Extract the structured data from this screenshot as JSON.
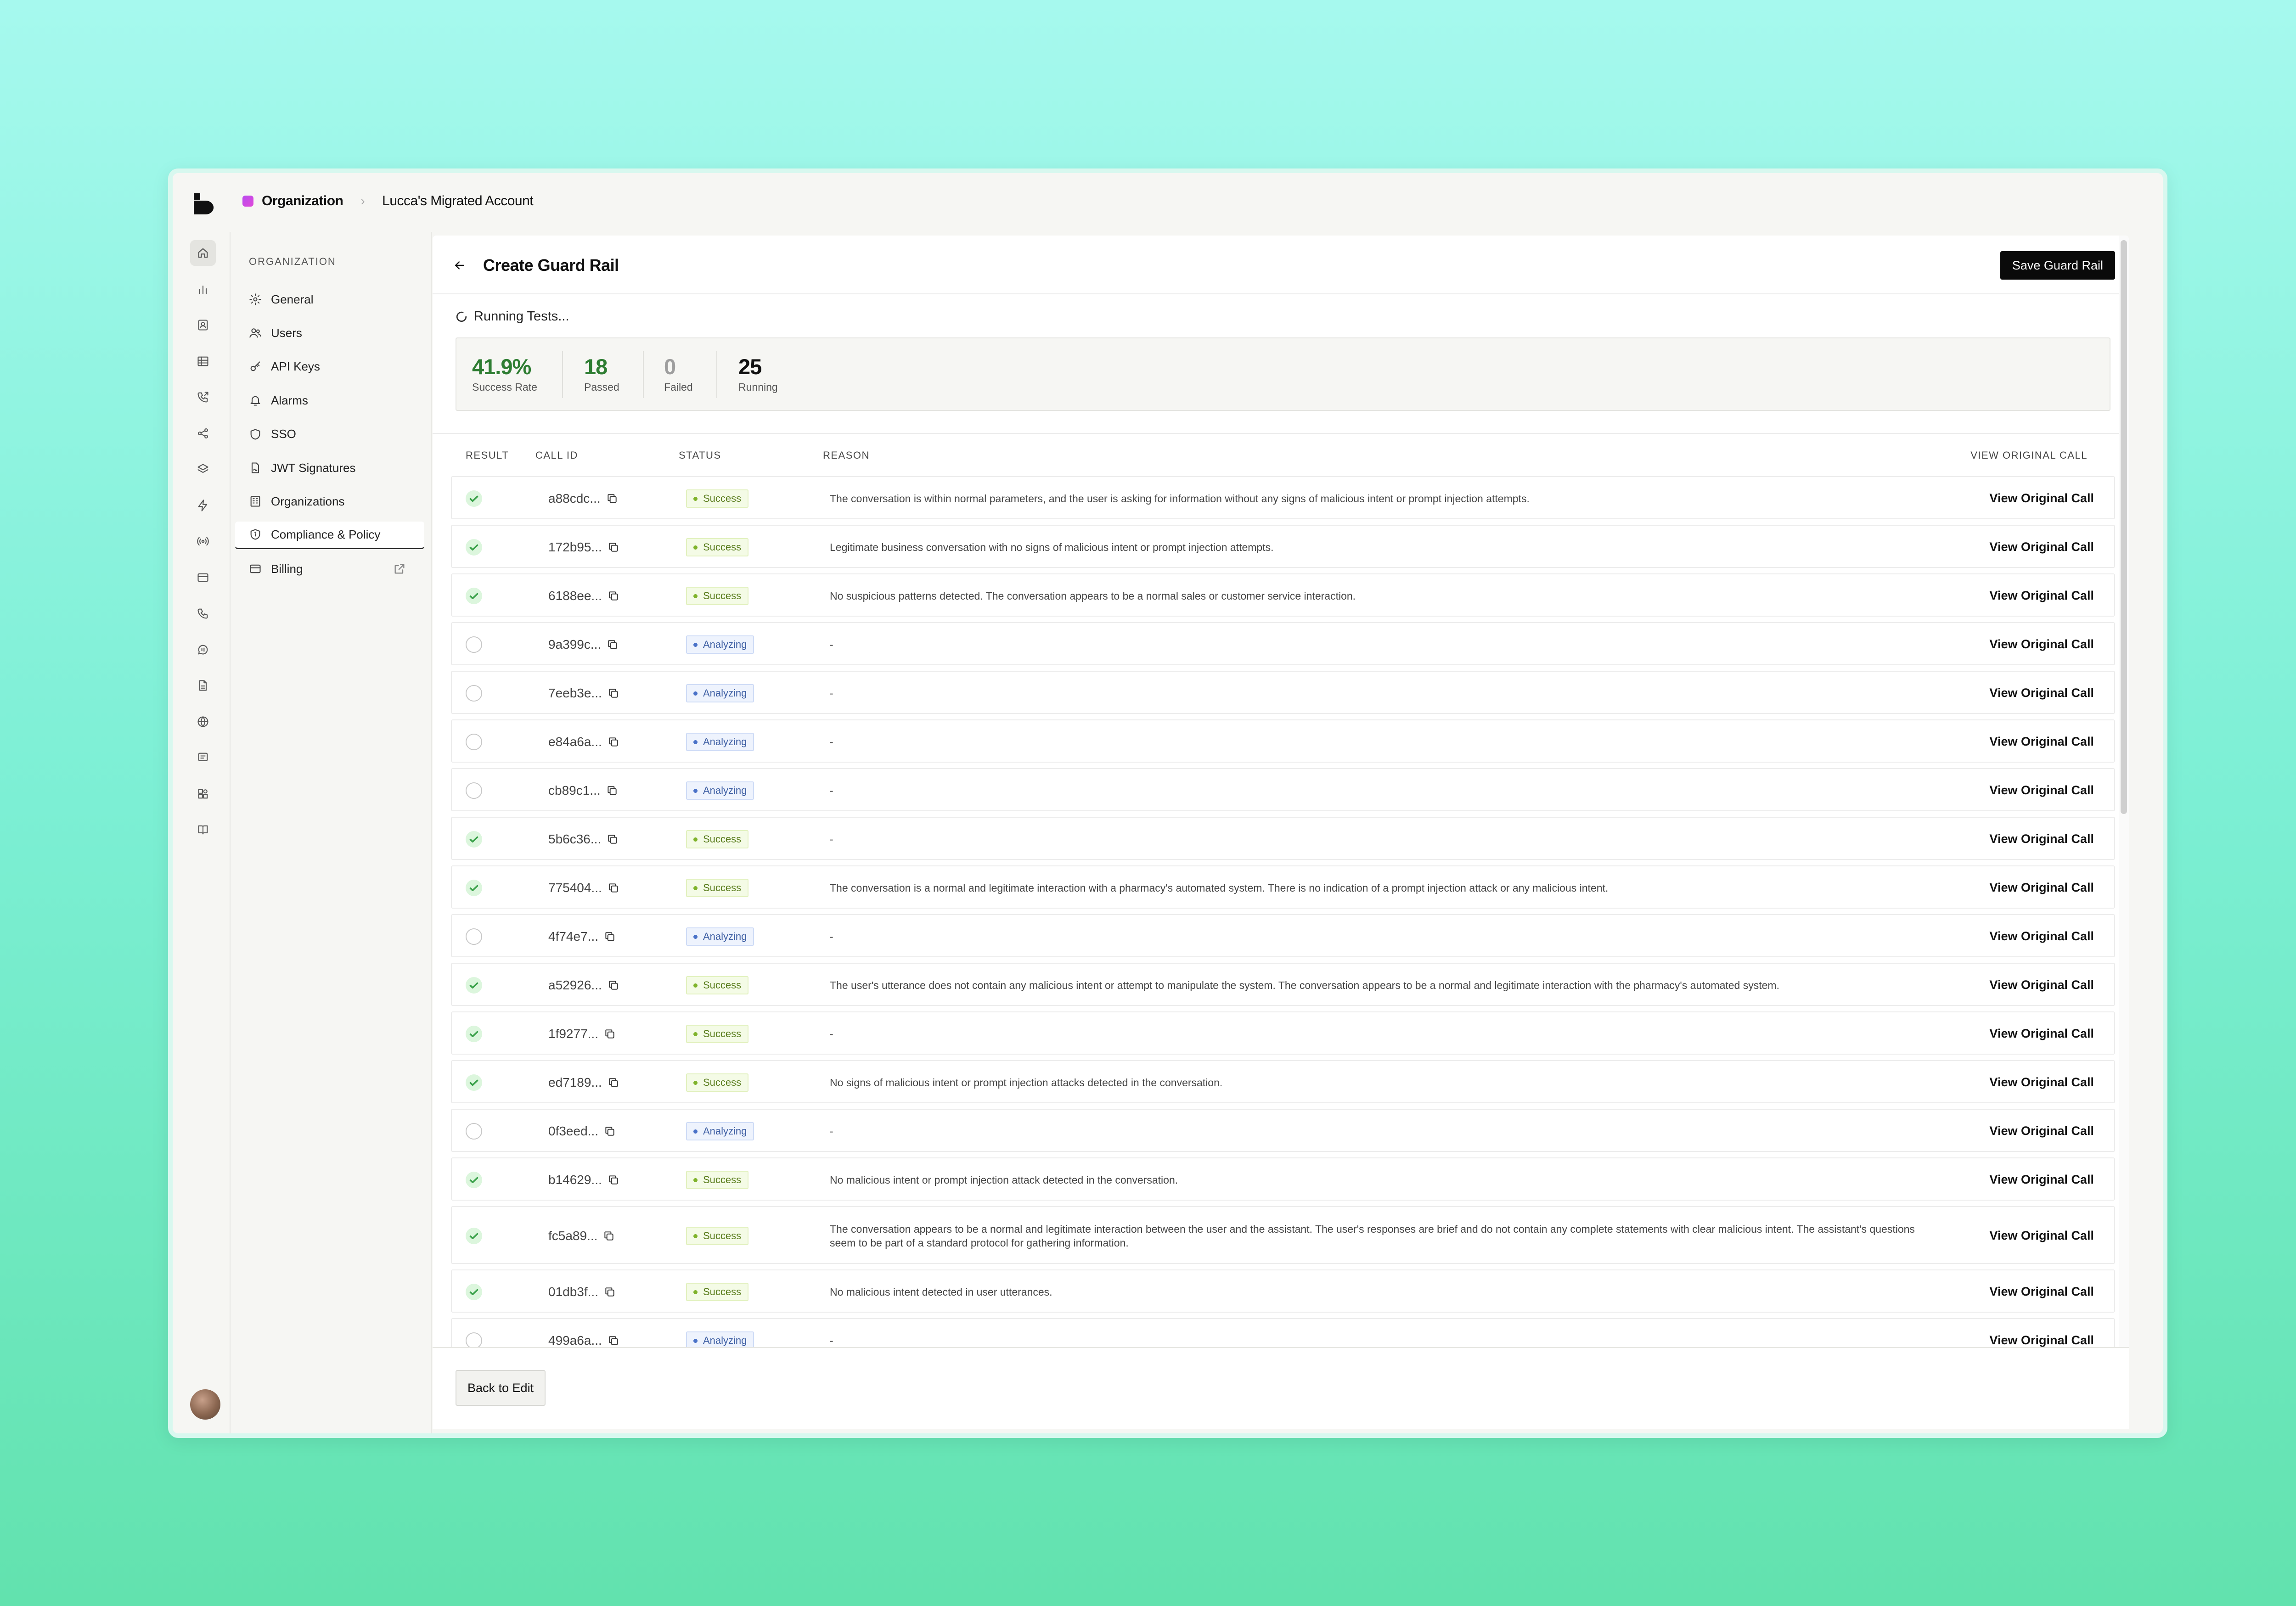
{
  "breadcrumb": {
    "org": "Organization",
    "separator": "›",
    "account": "Lucca's Migrated Account"
  },
  "rail_icons": [
    "home-icon",
    "chart-icon",
    "contacts-icon",
    "table-icon",
    "phone-forward-icon",
    "share-icon",
    "stack-icon",
    "lightning-icon",
    "broadcast-icon",
    "card-icon",
    "phone-icon",
    "chat-voice-icon",
    "document-icon",
    "globe-icon",
    "message-icon",
    "puzzle-icon",
    "book-icon"
  ],
  "settings_nav": {
    "heading": "ORGANIZATION",
    "items": [
      {
        "label": "General",
        "icon": "gear-icon"
      },
      {
        "label": "Users",
        "icon": "users-icon"
      },
      {
        "label": "API Keys",
        "icon": "key-icon"
      },
      {
        "label": "Alarms",
        "icon": "bell-icon"
      },
      {
        "label": "SSO",
        "icon": "shield-icon"
      },
      {
        "label": "JWT Signatures",
        "icon": "signature-doc-icon"
      },
      {
        "label": "Organizations",
        "icon": "building-icon"
      },
      {
        "label": "Compliance & Policy",
        "icon": "shield-check-icon",
        "active": true
      },
      {
        "label": "Billing",
        "icon": "card-icon",
        "external": true
      }
    ]
  },
  "header": {
    "title": "Create Guard Rail",
    "save_label": "Save Guard Rail"
  },
  "status": {
    "running_label": "Running Tests..."
  },
  "stats": {
    "success_rate": {
      "value": "41.9%",
      "label": "Success Rate",
      "color": "#2e7d32"
    },
    "passed": {
      "value": "18",
      "label": "Passed",
      "color": "#2e7d32"
    },
    "failed": {
      "value": "0",
      "label": "Failed",
      "color": "#9e9e9e"
    },
    "running": {
      "value": "25",
      "label": "Running",
      "color": "#111111"
    }
  },
  "table": {
    "headers": {
      "result": "RESULT",
      "call_id": "CALL ID",
      "status": "STATUS",
      "reason": "REASON",
      "view": "VIEW ORIGINAL CALL"
    },
    "view_label": "View Original Call",
    "rows": [
      {
        "result": "ok",
        "id": "a88cdc...",
        "status": "Success",
        "reason": "The conversation is within normal parameters, and the user is asking for information without any signs of malicious intent or prompt injection attempts."
      },
      {
        "result": "ok",
        "id": "172b95...",
        "status": "Success",
        "reason": "Legitimate business conversation with no signs of malicious intent or prompt injection attempts."
      },
      {
        "result": "ok",
        "id": "6188ee...",
        "status": "Success",
        "reason": "No suspicious patterns detected. The conversation appears to be a normal sales or customer service interaction."
      },
      {
        "result": "pending",
        "id": "9a399c...",
        "status": "Analyzing",
        "reason": "-"
      },
      {
        "result": "pending",
        "id": "7eeb3e...",
        "status": "Analyzing",
        "reason": "-"
      },
      {
        "result": "pending",
        "id": "e84a6a...",
        "status": "Analyzing",
        "reason": "-"
      },
      {
        "result": "pending",
        "id": "cb89c1...",
        "status": "Analyzing",
        "reason": "-"
      },
      {
        "result": "ok",
        "id": "5b6c36...",
        "status": "Success",
        "reason": "-"
      },
      {
        "result": "ok",
        "id": "775404...",
        "status": "Success",
        "reason": "The conversation is a normal and legitimate interaction with a pharmacy's automated system. There is no indication of a prompt injection attack or any malicious intent."
      },
      {
        "result": "pending",
        "id": "4f74e7...",
        "status": "Analyzing",
        "reason": "-"
      },
      {
        "result": "ok",
        "id": "a52926...",
        "status": "Success",
        "reason": "The user's utterance does not contain any malicious intent or attempt to manipulate the system. The conversation appears to be a normal and legitimate interaction with the pharmacy's automated system."
      },
      {
        "result": "ok",
        "id": "1f9277...",
        "status": "Success",
        "reason": "-"
      },
      {
        "result": "ok",
        "id": "ed7189...",
        "status": "Success",
        "reason": "No signs of malicious intent or prompt injection attacks detected in the conversation."
      },
      {
        "result": "pending",
        "id": "0f3eed...",
        "status": "Analyzing",
        "reason": "-"
      },
      {
        "result": "ok",
        "id": "b14629...",
        "status": "Success",
        "reason": "No malicious intent or prompt injection attack detected in the conversation."
      },
      {
        "result": "ok",
        "id": "fc5a89...",
        "status": "Success",
        "reason": "The conversation appears to be a normal and legitimate interaction between the user and the assistant. The user's responses are brief and do not contain any complete statements with clear malicious intent. The assistant's questions seem to be part of a standard protocol for gathering information.",
        "tall": true
      },
      {
        "result": "ok",
        "id": "01db3f...",
        "status": "Success",
        "reason": "No malicious intent detected in user utterances."
      },
      {
        "result": "pending",
        "id": "499a6a...",
        "status": "Analyzing",
        "reason": "-"
      }
    ]
  },
  "footer": {
    "back_label": "Back to Edit"
  }
}
